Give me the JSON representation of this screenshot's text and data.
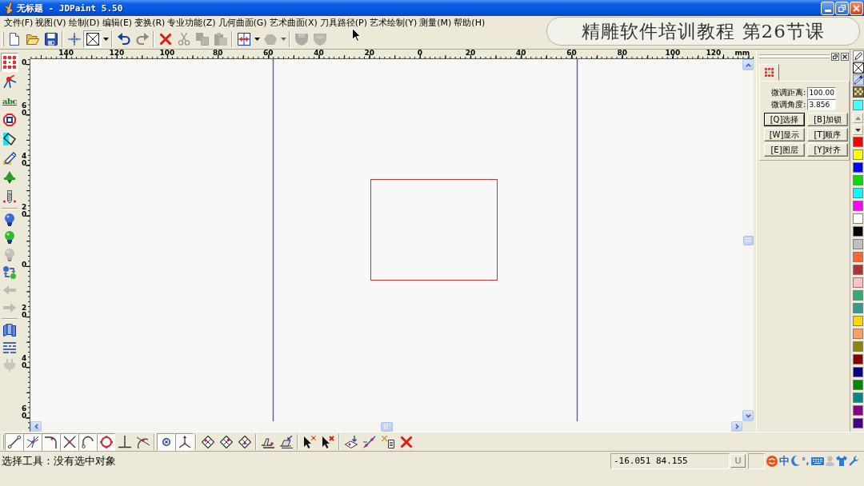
{
  "window": {
    "title": "无标题 - JDPaint 5.50"
  },
  "menu": [
    "文件(F)",
    "视图(V)",
    "绘制(D)",
    "编辑(E)",
    "变换(R)",
    "专业功能(Z)",
    "几何曲面(G)",
    "艺术曲面(X)",
    "刀具路径(P)",
    "艺术绘制(Y)",
    "测量(M)",
    "帮助(H)"
  ],
  "toolbar": [
    [
      {
        "kind": "button",
        "disabled": false,
        "pressed": false
      },
      {
        "kind": "button",
        "disabled": false,
        "pressed": false
      },
      {
        "kind": "button",
        "disabled": false,
        "pressed": false
      }
    ],
    [
      {
        "kind": "button",
        "disabled": false,
        "pressed": false
      },
      {
        "kind": "button",
        "disabled": false,
        "pressed": true
      },
      {
        "kind": "dropdown",
        "disabled": false,
        "pressed": false
      }
    ],
    [
      {
        "kind": "button",
        "disabled": false,
        "pressed": false
      },
      {
        "kind": "button",
        "disabled": true,
        "pressed": false
      }
    ],
    [
      {
        "kind": "button",
        "disabled": false,
        "pressed": false
      },
      {
        "kind": "button",
        "disabled": true,
        "pressed": false
      },
      {
        "kind": "button",
        "disabled": true,
        "pressed": false
      },
      {
        "kind": "button",
        "disabled": true,
        "pressed": false
      }
    ],
    [
      {
        "kind": "button",
        "disabled": false,
        "pressed": false
      },
      {
        "kind": "dropdown",
        "disabled": false,
        "pressed": false
      },
      {
        "kind": "button",
        "disabled": true,
        "pressed": false
      },
      {
        "kind": "dropdown",
        "disabled": true,
        "pressed": false
      }
    ],
    [
      {
        "kind": "button",
        "disabled": true,
        "pressed": false
      },
      {
        "kind": "button",
        "disabled": true,
        "pressed": false
      }
    ]
  ],
  "banner": {
    "text": "精雕软件培训教程 第26节课"
  },
  "left_toolbar": [
    [
      {
        "selected": true,
        "disabled": false
      },
      {
        "selected": false,
        "disabled": false
      },
      {
        "selected": false,
        "disabled": false,
        "text": "abc"
      },
      {
        "selected": false,
        "disabled": false
      },
      {
        "selected": false,
        "disabled": false
      },
      {
        "selected": false,
        "disabled": false
      },
      {
        "selected": false,
        "disabled": false
      },
      {
        "selected": false,
        "disabled": false
      }
    ],
    [
      {
        "selected": false,
        "disabled": false
      },
      {
        "selected": false,
        "disabled": false
      },
      {
        "selected": false,
        "disabled": true
      },
      {
        "selected": false,
        "disabled": false
      },
      {
        "selected": false,
        "disabled": true
      },
      {
        "selected": false,
        "disabled": true
      }
    ],
    [
      {
        "selected": false,
        "disabled": false
      },
      {
        "selected": false,
        "disabled": false
      },
      {
        "selected": false,
        "disabled": true
      }
    ]
  ],
  "rulers": {
    "horizontal": [
      "140",
      "120",
      "100",
      "80",
      "60",
      "40",
      "20",
      "0",
      "20",
      "40",
      "60",
      "80",
      "100",
      "120"
    ],
    "unit": "mm",
    "vertical": [
      "0",
      "60",
      "40",
      "20",
      "0",
      "20",
      "40",
      "60"
    ]
  },
  "panel": {
    "tabs": [
      {
        "selected": true
      }
    ],
    "fields": [
      {
        "label": "微调距离:",
        "value": "100.00"
      },
      {
        "label": "微调角度:",
        "value": "3.856"
      }
    ],
    "buttons": [
      {
        "label": "[Q]选择",
        "selected": true
      },
      {
        "label": "[B]加锁",
        "selected": false
      },
      {
        "label": "[W]显示",
        "selected": false
      },
      {
        "label": "[T]顺序",
        "selected": false
      },
      {
        "label": "[E]图层",
        "selected": false
      },
      {
        "label": "[Y]对齐",
        "selected": false
      }
    ]
  },
  "palette": {
    "current": {
      "color": "#40ffff"
    },
    "arrows": [
      {
        "disabled": true
      },
      {
        "disabled": false
      }
    ],
    "swatches": [
      {
        "color": "#ff0000"
      },
      {
        "color": "#ffff00"
      },
      {
        "color": "#0000ff"
      },
      {
        "color": "#00e000"
      },
      {
        "color": "#00ffff"
      },
      {
        "color": "#ff00ff"
      },
      {
        "color": "#ffffff"
      },
      {
        "color": "#000000"
      },
      {
        "color": "#c0c0c0"
      },
      {
        "color": "#ff6633"
      },
      {
        "color": "#aa3333"
      },
      {
        "color": "#ffc0cb"
      },
      {
        "color": "#33aa77"
      },
      {
        "color": "#339988"
      },
      {
        "color": "#ffd700"
      },
      {
        "color": "#ffa060"
      },
      {
        "color": "#888800"
      },
      {
        "color": "#880000"
      },
      {
        "color": "#000088"
      },
      {
        "color": "#008800"
      },
      {
        "color": "#008888"
      },
      {
        "color": "#880088"
      },
      {
        "color": "#440088"
      }
    ]
  },
  "bottom_toolbar": [
    [
      {
        "on": true
      },
      {
        "on": true
      },
      {
        "on": true
      },
      {
        "on": true
      },
      {
        "on": true
      },
      {
        "on": true
      },
      {
        "on": false
      },
      {
        "on": false
      }
    ],
    [
      {
        "on": true
      },
      {
        "on": true
      }
    ],
    [
      {
        "on": false
      },
      {
        "on": false
      },
      {
        "on": false
      }
    ],
    [
      {
        "on": false
      },
      {
        "on": false
      }
    ],
    [
      {
        "on": false
      },
      {
        "on": false
      }
    ],
    [
      {
        "on": false
      },
      {
        "on": false
      },
      {
        "on": false
      },
      {
        "on": false
      }
    ]
  ],
  "status_bar": {
    "message": "选择工具：没有选中对象",
    "coordinates": "-16.051 84.155",
    "unit_button": "U",
    "ime": {
      "language": "中",
      "punctuation": "°,"
    }
  }
}
